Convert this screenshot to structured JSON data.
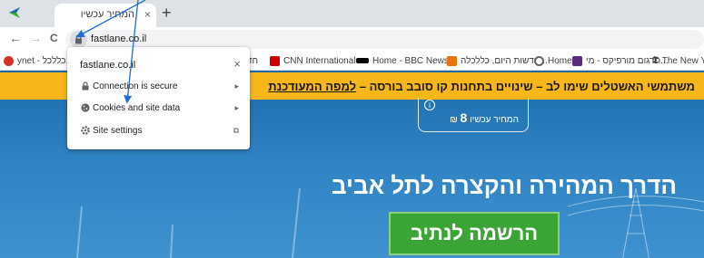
{
  "tab": {
    "title": "המחיר עכשיו",
    "close": "×",
    "new_tab": "+"
  },
  "nav": {
    "back": "←",
    "forward": "→",
    "reload": "C"
  },
  "omnibox": {
    "url": "fastlane.co.il"
  },
  "bookmarks": [
    {
      "label": "ynet - כללכל...",
      "color": "#d93025"
    },
    {
      "label": "חדשו",
      "color": "#ffffff"
    },
    {
      "label": "CNN International -...",
      "color": "#cc0000"
    },
    {
      "label": "Home - BBC News",
      "color": "#000000"
    },
    {
      "label": "חדשות היום, כללכלה...",
      "color": "#e8730c"
    },
    {
      "label": "Home",
      "color": "#5f6368"
    },
    {
      "label": "תרגום מורפיקס - מי...",
      "color": "#5b2b82"
    },
    {
      "label": "The New Yor",
      "color": "#000000"
    }
  ],
  "banner": {
    "text": "משתמשי האשטלים שימו לב – שינויים בתחנות קו סובב בורסה – ",
    "link": "למפה המעודכנת"
  },
  "price": {
    "info": "i",
    "label": "המחיר עכשיו",
    "value": "8",
    "currency": "₪"
  },
  "hero": {
    "headline": "הדרך המהירה והקצרה לתל אביב",
    "cta": "הרשמה לנתיב"
  },
  "popup": {
    "title": "fastlane.co.il",
    "close": "×",
    "rows": [
      {
        "label": "Connection is secure",
        "icon": "lock-icon",
        "arrow": "▸"
      },
      {
        "label": "Cookies and site data",
        "icon": "cookie-icon",
        "arrow": "▸"
      },
      {
        "label": "Site settings",
        "icon": "gear-icon",
        "arrow": "⧉"
      }
    ]
  },
  "colors": {
    "banner": "#f7b71b",
    "cta": "#3aa535",
    "page_bg": "#2e82c2",
    "annotation": "#1f6fd1"
  }
}
